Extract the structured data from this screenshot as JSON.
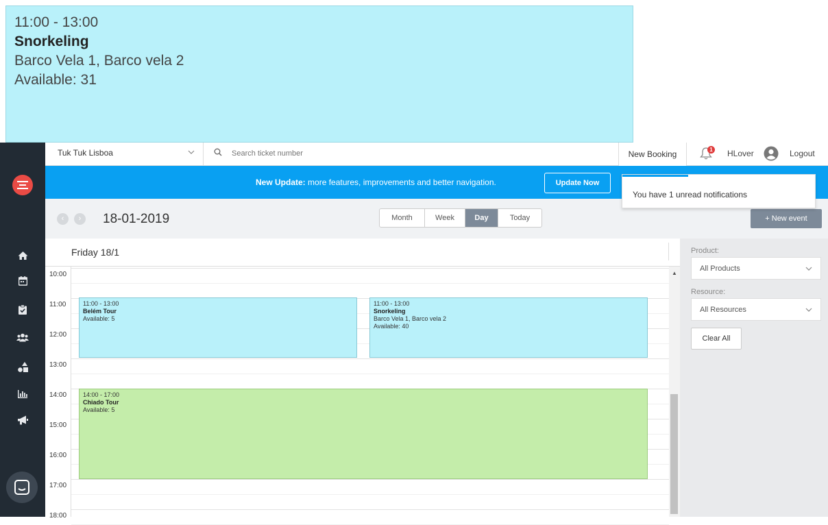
{
  "zoom_callout": {
    "time": "11:00 - 13:00",
    "title": "Snorkeling",
    "resources": "Barco Vela 1, Barco vela 2",
    "available": "Available: 31"
  },
  "topbar": {
    "company": "Tuk Tuk Lisboa",
    "search_placeholder": "Search ticket number",
    "new_booking": "New Booking",
    "notification_count": "1",
    "username": "HLover",
    "logout": "Logout"
  },
  "banner": {
    "bold": "New Update:",
    "text": " more features, improvements and better navigation.",
    "button": "Update Now",
    "color": "#09a0f2"
  },
  "notification_popup": {
    "text": "You have 1 unread notifications"
  },
  "calendar": {
    "date_title": "18-01-2019",
    "views": [
      "Month",
      "Week",
      "Day",
      "Today"
    ],
    "active_view": "Day",
    "new_event": "+ New event",
    "day_header": "Friday 18/1",
    "hours": [
      "10:00",
      "11:00",
      "12:00",
      "13:00",
      "14:00",
      "15:00",
      "16:00",
      "17:00",
      "18:00"
    ],
    "events": [
      {
        "time": "11:00 - 13:00",
        "title": "Belém Tour",
        "resources": "",
        "available": "Available: 5",
        "color": "#b9f1fa"
      },
      {
        "time": "11:00 - 13:00",
        "title": "Snorkeling",
        "resources": "Barco Vela 1, Barco vela 2",
        "available": "Available: 40",
        "color": "#b9f1fa"
      },
      {
        "time": "14:00 - 17:00",
        "title": "Chiado Tour",
        "resources": "",
        "available": "Available: 5",
        "color": "#c4edaa"
      }
    ]
  },
  "filters": {
    "product_label": "Product:",
    "product_value": "All Products",
    "resource_label": "Resource:",
    "resource_value": "All Resources",
    "clear_all": "Clear All"
  },
  "sidebar": {
    "icons": [
      "home-icon",
      "calendar-icon",
      "clipboard-check-icon",
      "users-icon",
      "shapes-icon",
      "bar-chart-icon",
      "megaphone-icon"
    ]
  }
}
